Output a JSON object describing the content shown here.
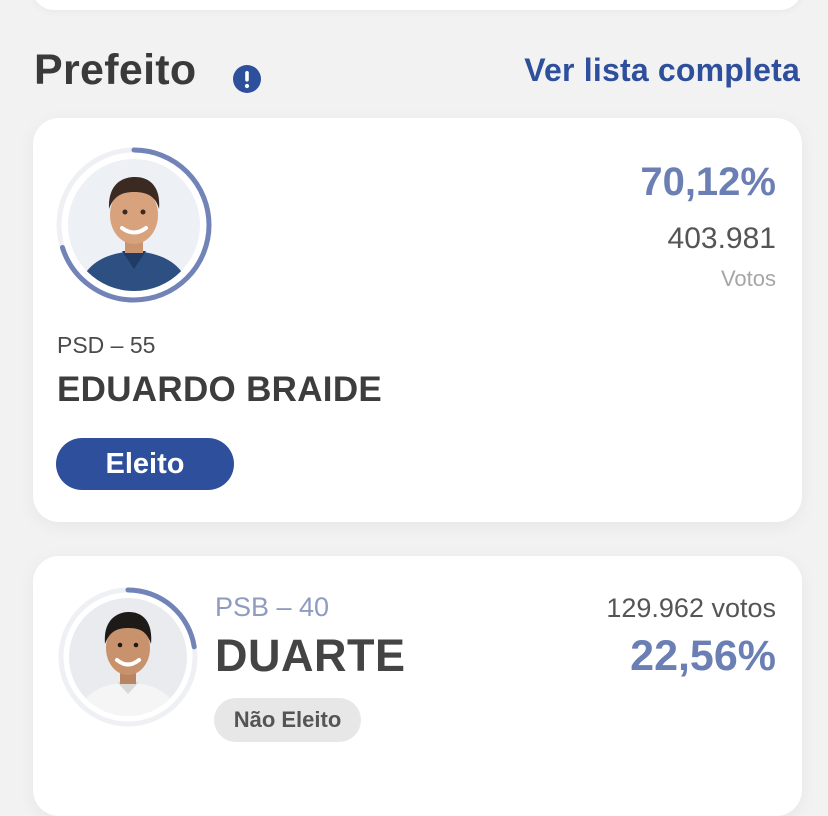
{
  "section": {
    "title": "Prefeito",
    "info_icon": "info-icon",
    "see_all_label": "Ver lista completa"
  },
  "colors": {
    "accent": "#2e4f9c",
    "percent": "#6b7fb4",
    "ring": "#7283b8",
    "not_elected_bg": "#e7e7e8"
  },
  "candidates": [
    {
      "party": "PSD – 55",
      "name": "EDUARDO BRAIDE",
      "percent": "70,12%",
      "votes": "403.981",
      "votes_label": "Votos",
      "status": "Eleito",
      "vote_share": 0.7012
    },
    {
      "party": "PSB – 40",
      "name": "DUARTE",
      "votes_text": "129.962 votos",
      "percent": "22,56%",
      "status": "Não Eleito",
      "vote_share": 0.2256
    }
  ]
}
